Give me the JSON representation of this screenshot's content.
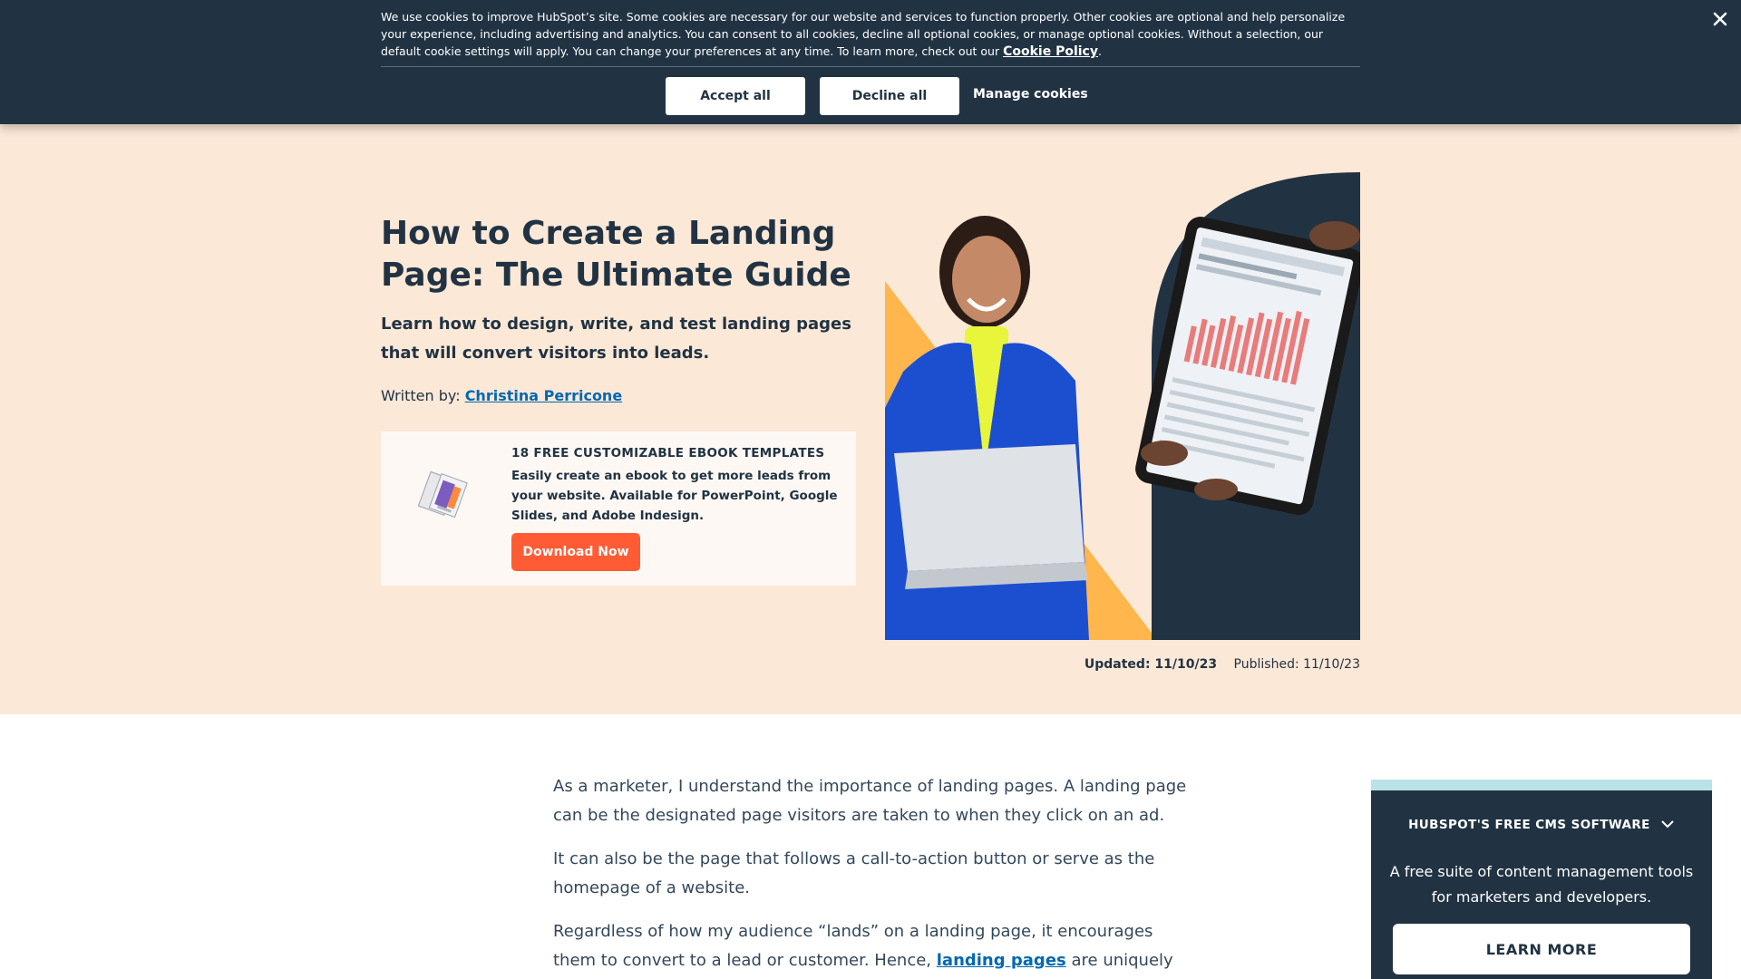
{
  "cookie_banner": {
    "text": "We use cookies to improve HubSpot’s site. Some cookies are necessary for our website and services to function properly. Other cookies are optional and help personalize your experience, including advertising and analytics. You can consent to all cookies, decline all optional cookies, or manage optional cookies. Without a selection, our default cookie settings will apply. You can change your preferences at any time. To learn more, check out our",
    "policy_link": "Cookie Policy",
    "policy_suffix": ".",
    "accept_label": "Accept all",
    "decline_label": "Decline all",
    "manage_label": "Manage cookies",
    "close_icon": "close-icon"
  },
  "hero": {
    "title": "How to Create a Landing Page: The Ultimate Guide",
    "subtitle": "Learn how to design, write, and test landing pages that will convert visitors into leads.",
    "byline_prefix": "Written by:",
    "author": "Christina Perricone",
    "updated": "Updated: 11/10/23",
    "published": "Published: 11/10/23",
    "background": "#fce8d7"
  },
  "ebook_offer": {
    "title": "18 FREE CUSTOMIZABLE EBOOK TEMPLATES",
    "description": "Easily create an ebook to get more leads from your website. Available for PowerPoint, Google Slides, and Adobe Indesign.",
    "button_label": "Download Now",
    "button_color": "#ff5c35"
  },
  "article": {
    "paragraphs": [
      "As a marketer, I understand the importance of landing pages. A landing page can be the designated page visitors are taken to when they click on an ad.",
      "It can also be the page that follows a call-to-action button or serve as the homepage of a website."
    ],
    "p3_before": "Regardless of how my audience “lands” on a landing page, it encourages them to convert to a lead or customer. Hence,",
    "p3_link": "landing pages",
    "p3_after": "are uniquely powerful"
  },
  "cms_card": {
    "heading": "HUBSPOT'S FREE CMS SOFTWARE",
    "chevron_icon": "chevron-down-icon",
    "description": "A free suite of content management tools for marketers and developers.",
    "button_label": "LEARN MORE",
    "accent": "#b9e3e6"
  },
  "colors": {
    "navy": "#213343",
    "link": "#0068b1",
    "orange": "#ff5c35"
  }
}
